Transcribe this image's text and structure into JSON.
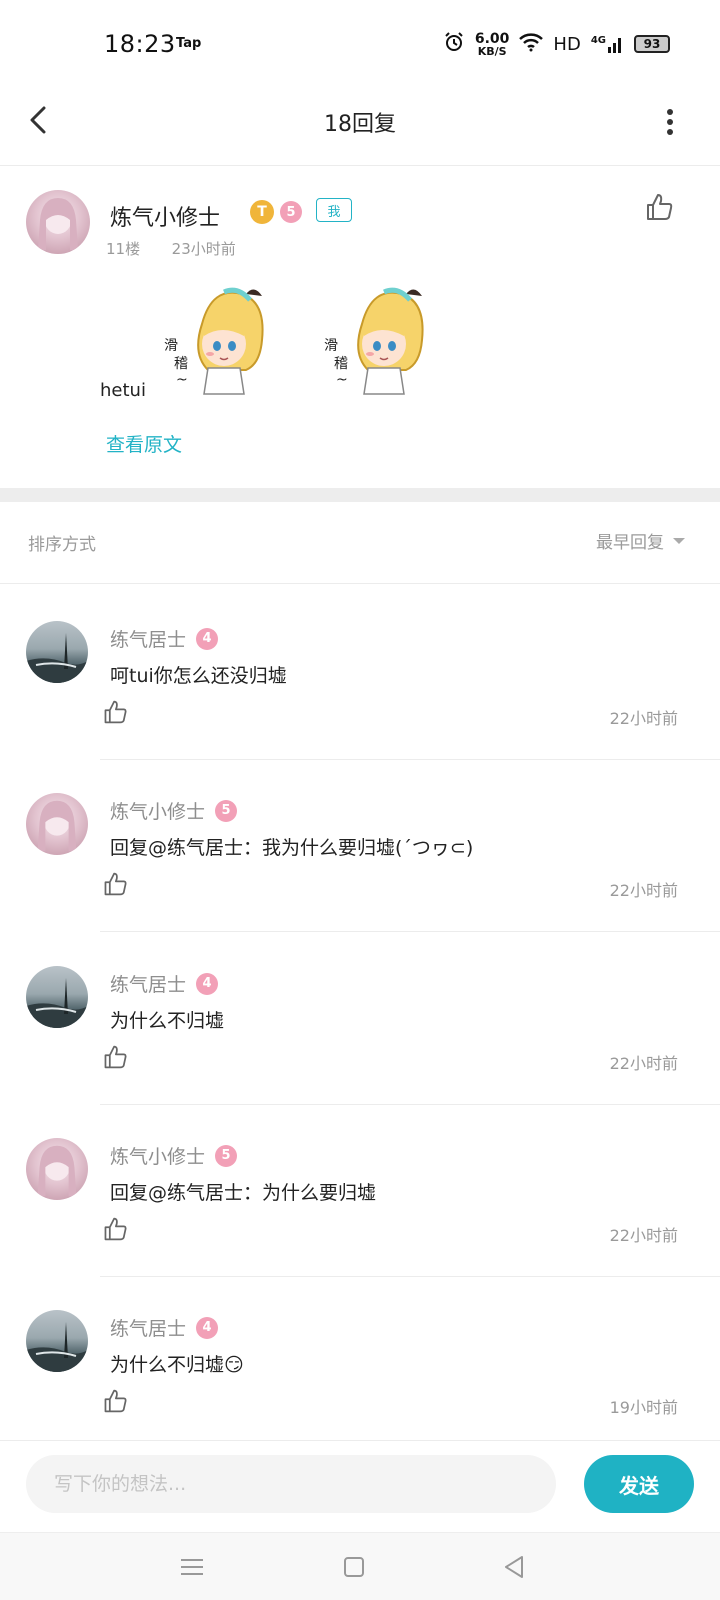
{
  "status_bar": {
    "time": "18:23",
    "app_tag": "Tap",
    "net_speed_value": "6.00",
    "net_speed_unit": "KB/S",
    "hd": "HD",
    "network": "4G",
    "battery": "93"
  },
  "header": {
    "title": "18回复"
  },
  "post": {
    "author": "炼气小修士",
    "badge_t": "T",
    "level": "5",
    "me_tag": "我",
    "floor": "11楼",
    "time": "23小时前",
    "text": "hetui",
    "view_original": "查看原文",
    "sticker_caption": "滑稽~"
  },
  "sort": {
    "label": "排序方式",
    "value": "最早回复"
  },
  "replies": [
    {
      "author": "练气居士",
      "level": "4",
      "text": "呵tui你怎么还没归墟",
      "time": "22小时前",
      "avatar": "sea"
    },
    {
      "author": "炼气小修士",
      "level": "5",
      "text": "回复@练气居士：我为什么要归墟(´つヮ⊂)",
      "time": "22小时前",
      "avatar": "girl"
    },
    {
      "author": "练气居士",
      "level": "4",
      "text": "为什么不归墟",
      "time": "22小时前",
      "avatar": "sea"
    },
    {
      "author": "炼气小修士",
      "level": "5",
      "text": "回复@练气居士：为什么要归墟",
      "time": "22小时前",
      "avatar": "girl"
    },
    {
      "author": "练气居士",
      "level": "4",
      "text": "为什么不归墟😏",
      "time": "19小时前",
      "avatar": "sea"
    }
  ],
  "input": {
    "placeholder": "写下你的想法...",
    "send_label": "发送"
  }
}
